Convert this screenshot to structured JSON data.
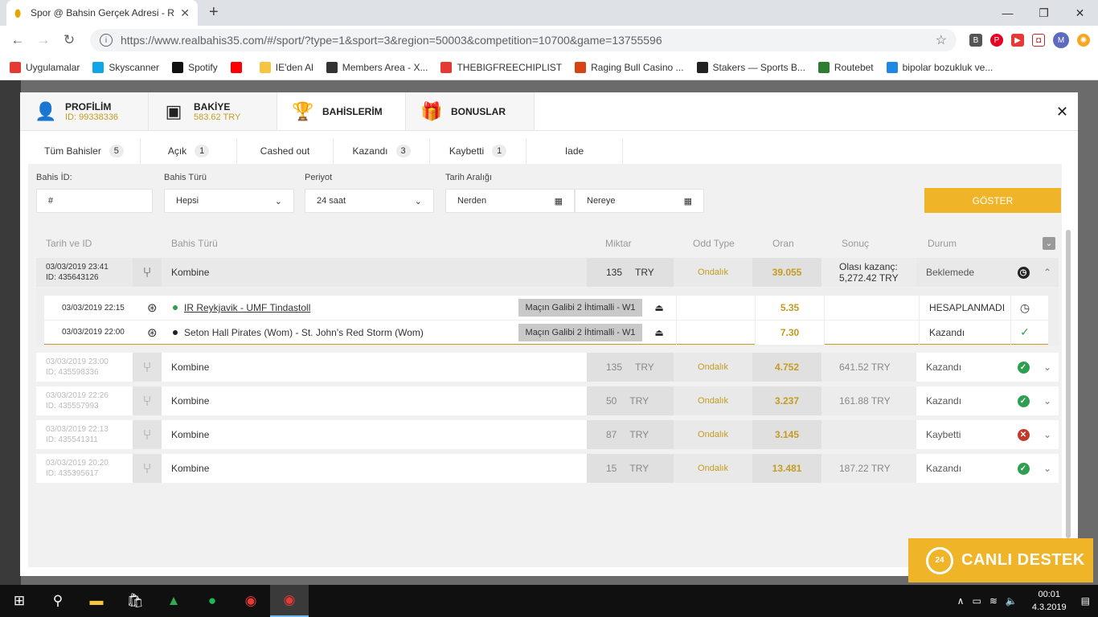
{
  "browser": {
    "tab_title": "Spor @ Bahsin Gerçek Adresi - R",
    "url": "https://www.realbahis35.com/#/sport/?type=1&sport=3&region=50003&competition=10700&game=13755596",
    "profile_initial": "M",
    "bookmarks": [
      {
        "label": "Uygulamalar",
        "color": "#e53935"
      },
      {
        "label": "Skyscanner",
        "color": "#0ea5e9"
      },
      {
        "label": "Spotify",
        "color": "#111111"
      },
      {
        "label": "",
        "color": "#ff0000"
      },
      {
        "label": "IE'den Al",
        "color": "#f5c542"
      },
      {
        "label": "Members Area - X...",
        "color": "#333333"
      },
      {
        "label": "THEBIGFREECHIPLIST",
        "color": "#e53935"
      },
      {
        "label": "Raging Bull Casino ...",
        "color": "#d84315"
      },
      {
        "label": "Stakers — Sports B...",
        "color": "#222222"
      },
      {
        "label": "Routebet",
        "color": "#2e7d32"
      },
      {
        "label": "bipolar bozukluk ve...",
        "color": "#1e88e5"
      }
    ]
  },
  "modal": {
    "tabs": [
      {
        "label": "PROFİLİM",
        "sub": "ID: 99338336",
        "icon": "user-icon"
      },
      {
        "label": "BAKİYE",
        "sub": "583.62 TRY",
        "icon": "wallet-icon"
      },
      {
        "label": "BAHİSLERİM",
        "sub": "",
        "icon": "trophy-icon"
      },
      {
        "label": "BONUSLAR",
        "sub": "",
        "icon": "gift-icon"
      }
    ],
    "filter_tabs": [
      {
        "label": "Tüm Bahisler",
        "count": "5"
      },
      {
        "label": "Açık",
        "count": "1"
      },
      {
        "label": "Cashed out",
        "count": ""
      },
      {
        "label": "Kazandı",
        "count": "3"
      },
      {
        "label": "Kaybetti",
        "count": "1"
      },
      {
        "label": "Iade",
        "count": ""
      }
    ],
    "filters": {
      "bahis_id_label": "Bahis İD:",
      "bahis_id_value": "#",
      "bahis_turu_label": "Bahis Türü",
      "bahis_turu_value": "Hepsi",
      "periyot_label": "Periyot",
      "periyot_value": "24 saat",
      "tarih_label": "Tarih Aralığı",
      "from_placeholder": "Nerden",
      "to_placeholder": "Nereye",
      "show_button": "GÖSTER"
    },
    "table_headers": {
      "date_id": "Tarih ve ID",
      "type": "Bahis Türü",
      "amount": "Miktar",
      "odd_type": "Odd Type",
      "oran": "Oran",
      "sonuc": "Sonuç",
      "durum": "Durum"
    },
    "bets": [
      {
        "date": "03/03/2019 23:41",
        "id": "ID: 435643126",
        "type": "Kombine",
        "amount": "135",
        "currency": "TRY",
        "odd_type": "Ondalık",
        "oran": "39.055",
        "sonuc_label": "Olası kazanç:",
        "sonuc": "5,272.42 TRY",
        "durum": "Beklemede",
        "status": "pending",
        "expanded": true
      },
      {
        "date": "03/03/2019 23:00",
        "id": "ID: 435598336",
        "type": "Kombine",
        "amount": "135",
        "currency": "TRY",
        "odd_type": "Ondalık",
        "oran": "4.752",
        "sonuc_label": "",
        "sonuc": "641.52 TRY",
        "durum": "Kazandı",
        "status": "won",
        "expanded": false
      },
      {
        "date": "03/03/2019 22:26",
        "id": "ID: 435557993",
        "type": "Kombine",
        "amount": "50",
        "currency": "TRY",
        "odd_type": "Ondalık",
        "oran": "3.237",
        "sonuc_label": "",
        "sonuc": "161.88 TRY",
        "durum": "Kazandı",
        "status": "won",
        "expanded": false
      },
      {
        "date": "03/03/2019 22:13",
        "id": "ID: 435541311",
        "type": "Kombine",
        "amount": "87",
        "currency": "TRY",
        "odd_type": "Ondalık",
        "oran": "3.145",
        "sonuc_label": "",
        "sonuc": "",
        "durum": "Kaybetti",
        "status": "lost",
        "expanded": false
      },
      {
        "date": "03/03/2019 20:20",
        "id": "ID: 435395617",
        "type": "Kombine",
        "amount": "15",
        "currency": "TRY",
        "odd_type": "Ondalık",
        "oran": "13.481",
        "sonuc_label": "",
        "sonuc": "187.22 TRY",
        "durum": "Kazandı",
        "status": "won",
        "expanded": false
      }
    ],
    "selections": [
      {
        "date": "03/03/2019 22:15",
        "match": "IR Reykjavik - UMF Tindastoll",
        "dot_color": "#2e9e4f",
        "market": "Maçın Galibi 2 İhtimalli - W1",
        "oran": "5.35",
        "durum": "HESAPLANMADI",
        "status": "clock"
      },
      {
        "date": "03/03/2019 22:00",
        "match": "Seton Hall Pirates (Wom) - St. John's Red Storm (Wom)",
        "dot_color": "#222222",
        "market": "Maçın Galibi 2 İhtimalli - W1",
        "oran": "7.30",
        "durum": "Kazandı",
        "status": "check"
      }
    ]
  },
  "support": {
    "label": "CANLI DESTEK",
    "badge": "24"
  },
  "taskbar": {
    "time": "00:01",
    "date": "4.3.2019"
  },
  "colors": {
    "accent": "#f0b429",
    "gold_text": "#c49b21",
    "won": "#2e9e4f",
    "lost": "#c0392b"
  }
}
